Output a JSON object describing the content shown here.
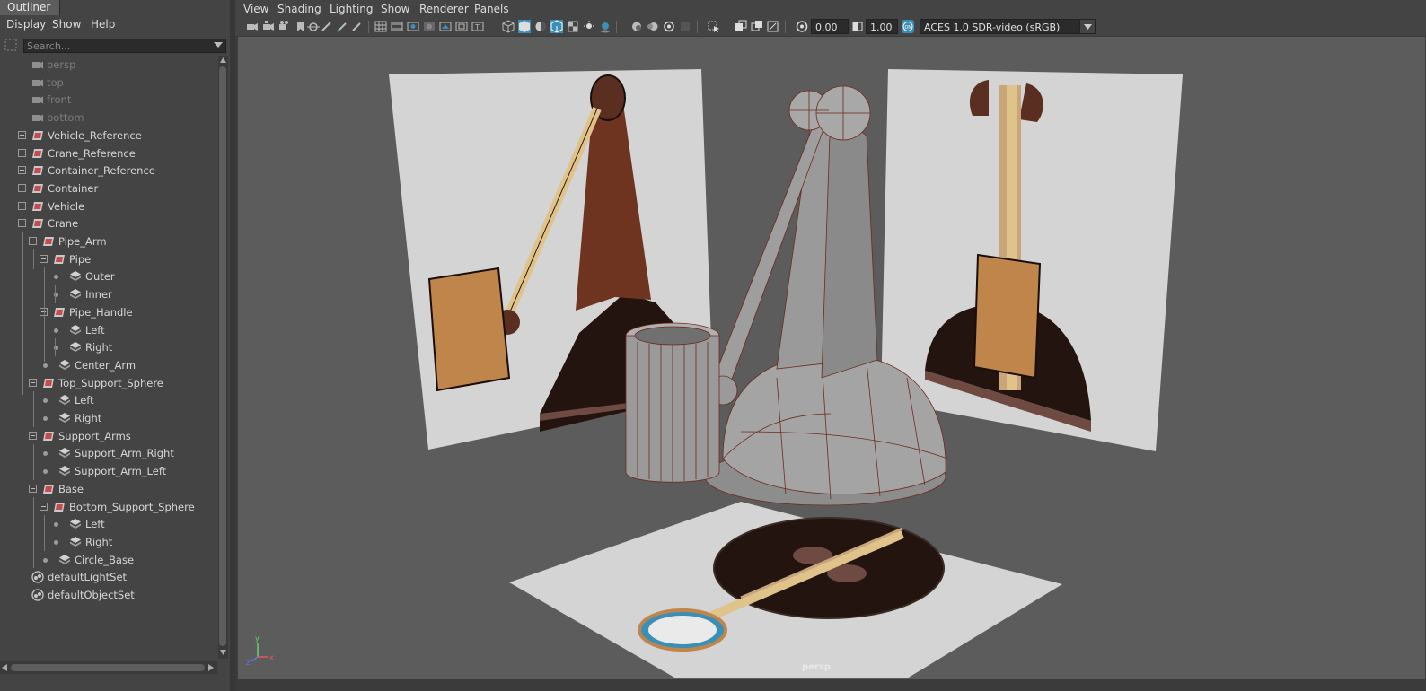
{
  "outliner": {
    "tab_label": "Outliner",
    "menu": [
      "Display",
      "Show",
      "Help"
    ],
    "search_placeholder": "Search...",
    "items": [
      {
        "label": "persp",
        "depth": 0,
        "type": "camera",
        "dim": true
      },
      {
        "label": "top",
        "depth": 0,
        "type": "camera",
        "dim": true
      },
      {
        "label": "front",
        "depth": 0,
        "type": "camera",
        "dim": true
      },
      {
        "label": "bottom",
        "depth": 0,
        "type": "camera",
        "dim": true
      },
      {
        "label": "Vehicle_Reference",
        "depth": 0,
        "type": "group",
        "expander": "plus"
      },
      {
        "label": "Crane_Reference",
        "depth": 0,
        "type": "group",
        "expander": "plus"
      },
      {
        "label": "Container_Reference",
        "depth": 0,
        "type": "group",
        "expander": "plus"
      },
      {
        "label": "Container",
        "depth": 0,
        "type": "group",
        "expander": "plus"
      },
      {
        "label": "Vehicle",
        "depth": 0,
        "type": "group",
        "expander": "plus"
      },
      {
        "label": "Crane",
        "depth": 0,
        "type": "group",
        "expander": "minus"
      },
      {
        "label": "Pipe_Arm",
        "depth": 1,
        "type": "group",
        "expander": "minus"
      },
      {
        "label": "Pipe",
        "depth": 2,
        "type": "group",
        "expander": "minus"
      },
      {
        "label": "Outer",
        "depth": 3,
        "type": "mesh"
      },
      {
        "label": "Inner",
        "depth": 3,
        "type": "mesh"
      },
      {
        "label": "Pipe_Handle",
        "depth": 2,
        "type": "group",
        "expander": "minus"
      },
      {
        "label": "Left",
        "depth": 3,
        "type": "mesh"
      },
      {
        "label": "Right",
        "depth": 3,
        "type": "mesh"
      },
      {
        "label": "Center_Arm",
        "depth": 2,
        "type": "mesh"
      },
      {
        "label": "Top_Support_Sphere",
        "depth": 1,
        "type": "group",
        "expander": "minus"
      },
      {
        "label": "Left",
        "depth": 2,
        "type": "mesh"
      },
      {
        "label": "Right",
        "depth": 2,
        "type": "mesh"
      },
      {
        "label": "Support_Arms",
        "depth": 1,
        "type": "group",
        "expander": "minus"
      },
      {
        "label": "Support_Arm_Right",
        "depth": 2,
        "type": "mesh"
      },
      {
        "label": "Support_Arm_Left",
        "depth": 2,
        "type": "mesh"
      },
      {
        "label": "Base",
        "depth": 1,
        "type": "group",
        "expander": "minus"
      },
      {
        "label": "Bottom_Support_Sphere",
        "depth": 2,
        "type": "group",
        "expander": "minus"
      },
      {
        "label": "Left",
        "depth": 3,
        "type": "mesh"
      },
      {
        "label": "Right",
        "depth": 3,
        "type": "mesh"
      },
      {
        "label": "Circle_Base",
        "depth": 2,
        "type": "mesh"
      },
      {
        "label": "defaultLightSet",
        "depth": 0,
        "type": "set"
      },
      {
        "label": "defaultObjectSet",
        "depth": 0,
        "type": "set"
      }
    ]
  },
  "viewport": {
    "menu": [
      "View",
      "Shading",
      "Lighting",
      "Show",
      "Renderer",
      "Panels"
    ],
    "exposure": "0.00",
    "gamma": "1.00",
    "color_space": "ACES 1.0 SDR-video (sRGB)",
    "camera_label": "persp",
    "axis_labels": [
      "y",
      "z",
      "x"
    ]
  },
  "colors": {
    "panel_bg": "#444444",
    "viewport_bg": "#5c5c5c",
    "accent_blue": "#3a8fb7",
    "mesh_grey": "#9c9c9c",
    "wire": "#6e2a1f",
    "dark_brown": "#24140f",
    "rust": "#6e3420",
    "orange": "#c0854a",
    "tan": "#e0c38a"
  }
}
